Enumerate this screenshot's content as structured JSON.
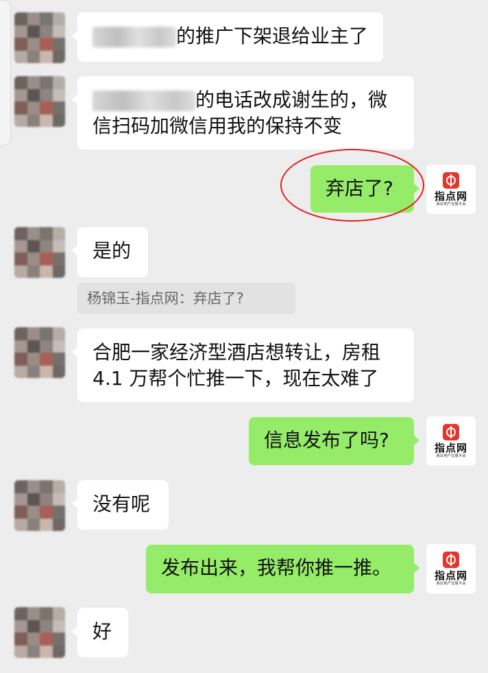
{
  "chat": {
    "brand": {
      "name": "指点网",
      "subtitle": "商业地产交易平台",
      "accent": "#e3362d"
    },
    "bubble_colors": {
      "incoming": "#ffffff",
      "outgoing": "#95ec69",
      "background": "#ededed"
    },
    "messages": [
      {
        "side": "left",
        "text": "的推广下架退给业主了"
      },
      {
        "side": "left",
        "text": "的电话改成谢生的，微",
        "text2": "信扫码加微信用我的保持不变"
      },
      {
        "side": "right",
        "text": "弃店了?"
      },
      {
        "side": "left",
        "text": "是的"
      },
      {
        "side": "quote",
        "text": "杨锦玉-指点网：弃店了?"
      },
      {
        "side": "left",
        "text": "合肥一家经济型酒店想转让，房租",
        "text2": "4.1 万帮个忙推一下，现在太难了"
      },
      {
        "side": "right",
        "text": "信息发布了吗?"
      },
      {
        "side": "left",
        "text": "没有呢"
      },
      {
        "side": "right",
        "text": "发布出来，我帮你推一推。"
      },
      {
        "side": "left",
        "text": "好"
      }
    ]
  }
}
